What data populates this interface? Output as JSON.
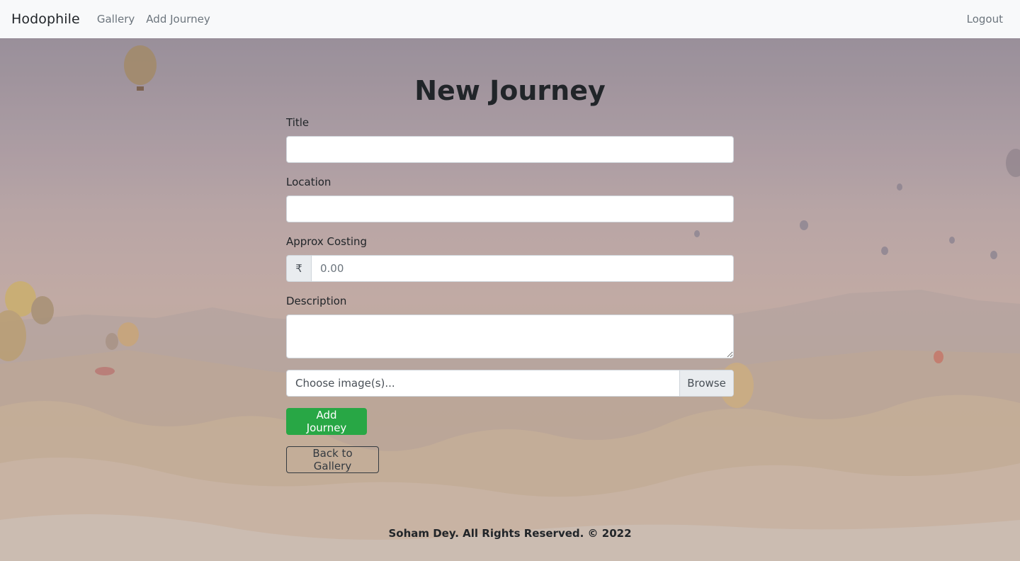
{
  "navbar": {
    "brand": "Hodophile",
    "links": [
      "Gallery",
      "Add Journey"
    ],
    "logout": "Logout"
  },
  "form": {
    "heading": "New Journey",
    "title_label": "Title",
    "title_value": "",
    "location_label": "Location",
    "location_value": "",
    "cost_label": "Approx Costing",
    "currency_symbol": "₹",
    "cost_placeholder": "0.00",
    "description_label": "Description",
    "description_value": "",
    "file_label": "Choose image(s)...",
    "browse_label": "Browse",
    "submit_label": "Add Journey",
    "back_label": "Back to Gallery"
  },
  "footer": {
    "text": "Soham Dey. All Rights Reserved. © 2022"
  },
  "colors": {
    "navbar_bg": "#f8f9fa",
    "success": "#28a745",
    "text_dark": "#212529",
    "muted": "#6c757d"
  },
  "icons": {
    "currency": "rupee-icon"
  }
}
